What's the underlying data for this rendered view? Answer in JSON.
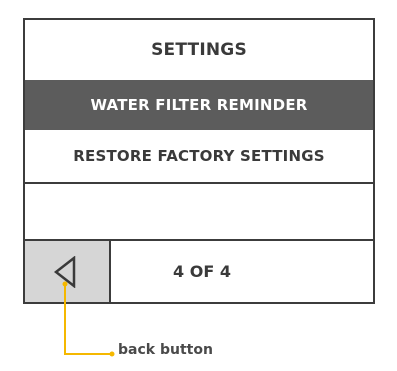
{
  "menu": {
    "title": "SETTINGS",
    "items": [
      {
        "label": "WATER FILTER REMINDER",
        "selected": true
      },
      {
        "label": "RESTORE FACTORY SETTINGS",
        "selected": false
      }
    ]
  },
  "nav": {
    "back_icon": "triangle-left-outline",
    "page_indicator": "4 OF 4"
  },
  "annotation": {
    "label": "back button",
    "color": "#f5b800"
  },
  "colors": {
    "selected_bg": "#5c5c5c",
    "back_button_bg": "#d6d6d6",
    "border": "#3c3c3c"
  }
}
